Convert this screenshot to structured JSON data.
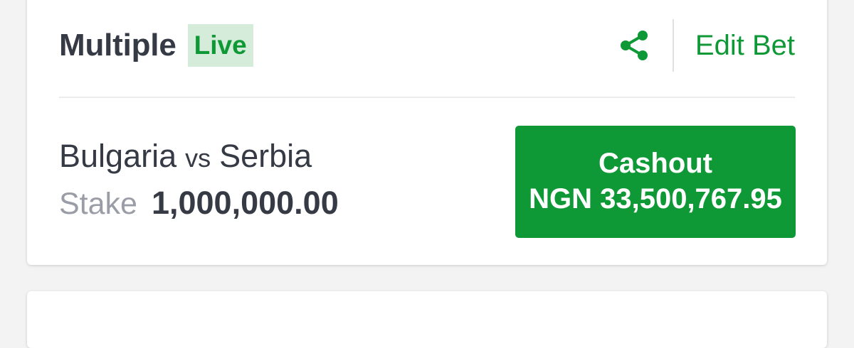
{
  "bet": {
    "title": "Multiple",
    "status_badge": "Live",
    "edit_label": "Edit Bet",
    "share_icon": "share-icon"
  },
  "match": {
    "home": "Bulgaria",
    "vs": "vs",
    "away": "Serbia"
  },
  "stake": {
    "label": "Stake",
    "value": "1,000,000.00"
  },
  "cashout": {
    "label": "Cashout",
    "amount": "NGN 33,500,767.95"
  },
  "colors": {
    "accent": "#0f9936",
    "badge_bg": "#d6ecda",
    "text_primary": "#353a45",
    "text_muted": "#9a9ca6"
  }
}
